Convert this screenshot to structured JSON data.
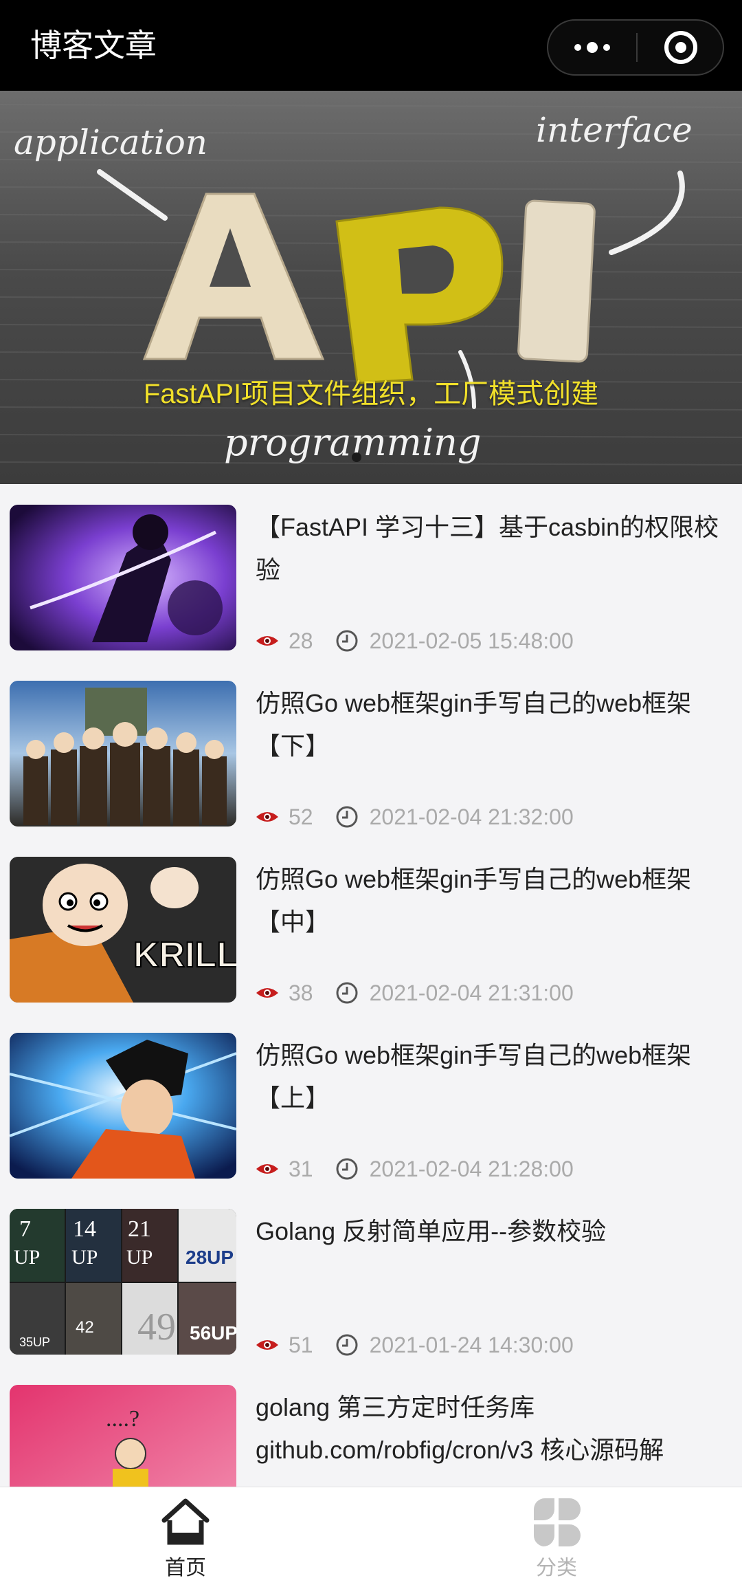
{
  "navbar": {
    "title": "博客文章"
  },
  "banner": {
    "caption": "FastAPI项目文件组织，工厂模式创建"
  },
  "articles": [
    {
      "title": "【FastAPI 学习十三】基于casbin的权限校验",
      "views": "28",
      "datetime": "2021-02-05 15:48:00"
    },
    {
      "title": "仿照Go web框架gin手写自己的web框架【下】",
      "views": "52",
      "datetime": "2021-02-04 21:32:00"
    },
    {
      "title": "仿照Go web框架gin手写自己的web框架【中】",
      "views": "38",
      "datetime": "2021-02-04 21:31:00"
    },
    {
      "title": "仿照Go web框架gin手写自己的web框架【上】",
      "views": "31",
      "datetime": "2021-02-04 21:28:00"
    },
    {
      "title": "Golang 反射简单应用--参数校验",
      "views": "51",
      "datetime": "2021-01-24 14:30:00"
    },
    {
      "title": "golang 第三方定时任务库github.com/robfig/cron/v3 核心源码解",
      "views": "",
      "datetime": ""
    }
  ],
  "tabbar": {
    "tabs": [
      {
        "label": "首页",
        "icon": "home-icon",
        "active": true,
        "color": "#222222"
      },
      {
        "label": "分类",
        "icon": "category-icon",
        "active": false,
        "color": "#b4b4b4"
      }
    ]
  }
}
